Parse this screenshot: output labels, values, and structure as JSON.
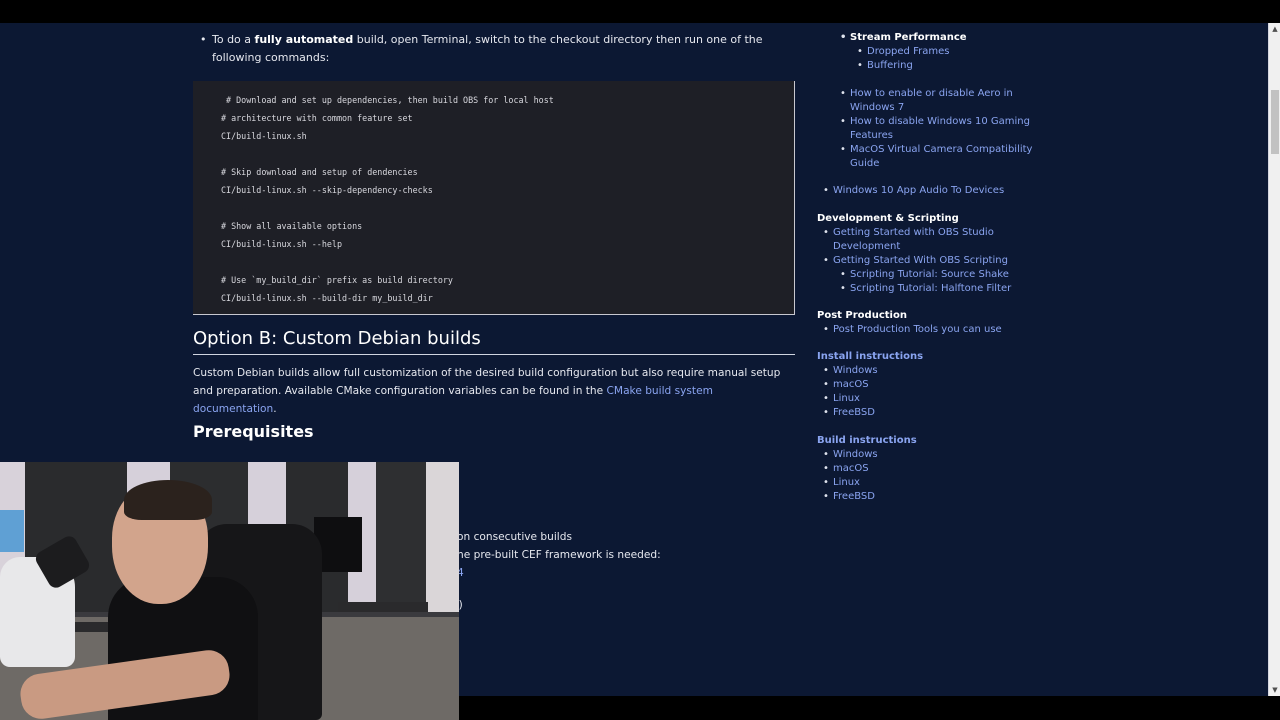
{
  "main": {
    "bullet": {
      "prefix": "To do a ",
      "bold": "fully automated",
      "suffix": " build, open Terminal, switch to the checkout directory then run one of the following commands:"
    },
    "code_lines": [
      " # Download and set up dependencies, then build OBS for local host",
      "# architecture with common feature set",
      "CI/build-linux.sh",
      "",
      "# Skip download and setup of dendencies",
      "CI/build-linux.sh --skip-dependency-checks",
      "",
      "# Show all available options",
      "CI/build-linux.sh --help",
      "",
      "# Use `my_build_dir` prefix as build directory",
      "CI/build-linux.sh --build-dir my_build_dir"
    ],
    "heading_option_b": "Option B: Custom Debian builds",
    "paragraph": {
      "text": "Custom Debian builds allow full customization of the desired build configuration but also require manual setup and preparation. Available CMake configuration variables can be found in the ",
      "link": "CMake build system documentation",
      "end": "."
    },
    "heading_prerequisites": "Prerequisites",
    "partial_lines": [
      {
        "text": "on consecutive builds",
        "link": false
      },
      {
        "text": "ne pre-built CEF framework is needed:",
        "link": false
      },
      {
        "text": "4",
        "link": true
      },
      {
        "text": "/)",
        "link": false
      }
    ]
  },
  "sidebar": {
    "stream_performance": "Stream Performance",
    "dropped_frames": "Dropped Frames",
    "buffering": "Buffering",
    "aero_line1": "How to enable or disable Aero in",
    "aero_line2": "Windows 7",
    "gaming_line1": "How to disable Windows 10 Gaming",
    "gaming_line2": "Features",
    "macos_cam_line1": "MacOS Virtual Camera Compatibility",
    "macos_cam_line2": "Guide",
    "app_audio": "Windows 10 App Audio To Devices",
    "dev_scripting": "Development & Scripting",
    "getting_started_dev_line1": "Getting Started with OBS Studio",
    "getting_started_dev_line2": "Development",
    "getting_started_scripting": "Getting Started With OBS Scripting",
    "source_shake": "Scripting Tutorial: Source Shake",
    "halftone": "Scripting Tutorial: Halftone Filter",
    "post_production": "Post Production",
    "post_tools": "Post Production Tools you can use",
    "install_instructions": "Install instructions",
    "install_items": [
      "Windows",
      "macOS",
      "Linux",
      "FreeBSD"
    ],
    "build_instructions": "Build instructions",
    "build_items": [
      "Windows",
      "macOS",
      "Linux",
      "FreeBSD"
    ]
  },
  "scrollbar": {
    "up_icon": "▲",
    "down_icon": "▼"
  },
  "colors": {
    "page_bg": "#0c1833",
    "link": "#8aa4f0",
    "code_bg": "#1e1f26"
  }
}
